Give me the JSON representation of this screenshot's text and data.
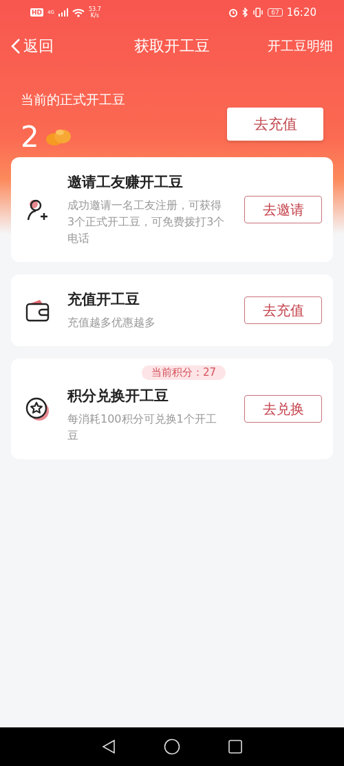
{
  "status_bar": {
    "hd": "HD",
    "network": "4G",
    "speed": "53.7",
    "speed_unit": "K/s",
    "battery": "67",
    "time": "16:20"
  },
  "nav": {
    "back": "返回",
    "title": "获取开工豆",
    "action": "开工豆明细"
  },
  "balance": {
    "label": "当前的正式开工豆",
    "value": "2",
    "button": "去充值"
  },
  "cards": [
    {
      "kind": "invite",
      "title": "邀请工友赚开工豆",
      "desc": "成功邀请一名工友注册，可获得3个正式开工豆，可免费拨打3个电话",
      "button": "去邀请"
    },
    {
      "kind": "recharge",
      "title": "充值开工豆",
      "desc": "充值越多优惠越多",
      "button": "去充值"
    },
    {
      "kind": "exchange",
      "title": "积分兑换开工豆",
      "desc": "每消耗100积分可兑换1个开工豆",
      "button": "去兑换",
      "badge": "当前积分：27"
    }
  ]
}
